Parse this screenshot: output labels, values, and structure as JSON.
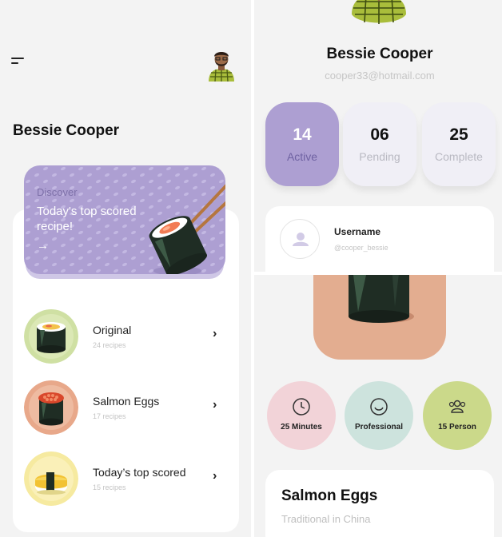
{
  "home": {
    "user_name": "Bessie Cooper",
    "discover": {
      "label": "Discover",
      "headline": "Today's top scored recipe!",
      "arrow": "→"
    },
    "recipes": [
      {
        "name": "Original",
        "count": "24 recipes",
        "thumb_color": "#cfe0a3"
      },
      {
        "name": "Salmon Eggs",
        "count": "17 recipes",
        "thumb_color": "#e8a88a"
      },
      {
        "name": "Today’s top scored",
        "count": "15 recipes",
        "thumb_color": "#f6eaa0"
      }
    ],
    "chevron": "›"
  },
  "profile": {
    "name": "Bessie Cooper",
    "email": "cooper33@hotmail.com",
    "stats": [
      {
        "value": "14",
        "label": "Active"
      },
      {
        "value": "06",
        "label": "Pending"
      },
      {
        "value": "25",
        "label": "Complete"
      }
    ],
    "username_label": "Username",
    "username_handle": "@cooper_bessie"
  },
  "recipe_detail": {
    "info": [
      {
        "text": "25 Minutes",
        "icon": "clock-icon",
        "color": "#f2d3d8"
      },
      {
        "text": "Professional",
        "icon": "smiley-icon",
        "color": "#cde3dd"
      },
      {
        "text": "15 Person",
        "icon": "people-icon",
        "color": "#cbd98a"
      }
    ],
    "title": "Salmon Eggs",
    "subtitle": "Traditional in China"
  },
  "colors": {
    "accent_purple": "#ad9fd2",
    "background": "#f3f3f3"
  }
}
